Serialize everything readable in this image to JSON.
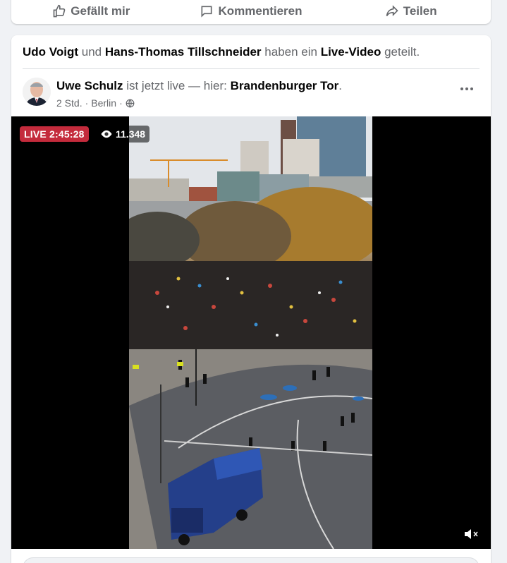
{
  "actions": {
    "like": "Gefällt mir",
    "comment": "Kommentieren",
    "share": "Teilen"
  },
  "post": {
    "shared_by_1": "Udo Voigt",
    "shared_connector": "und",
    "shared_by_2": "Hans-Thomas Tillschneider",
    "shared_verb": "haben ein",
    "shared_object": "Live-Video",
    "shared_suffix": "geteilt.",
    "author": "Uwe Schulz",
    "status_text": "ist jetzt live — hier:",
    "location": "Brandenburger Tor",
    "period": ".",
    "time": "2 Std.",
    "dot": "·",
    "place": "Berlin",
    "privacy_icon": "globe-icon"
  },
  "video": {
    "live_label": "LIVE 2:45:28",
    "viewer_count": "11.348",
    "mute_icon": "speaker-muted-icon"
  },
  "colors": {
    "live_red": "#c42b3c",
    "text_primary": "#050505",
    "text_secondary": "#65676b"
  }
}
